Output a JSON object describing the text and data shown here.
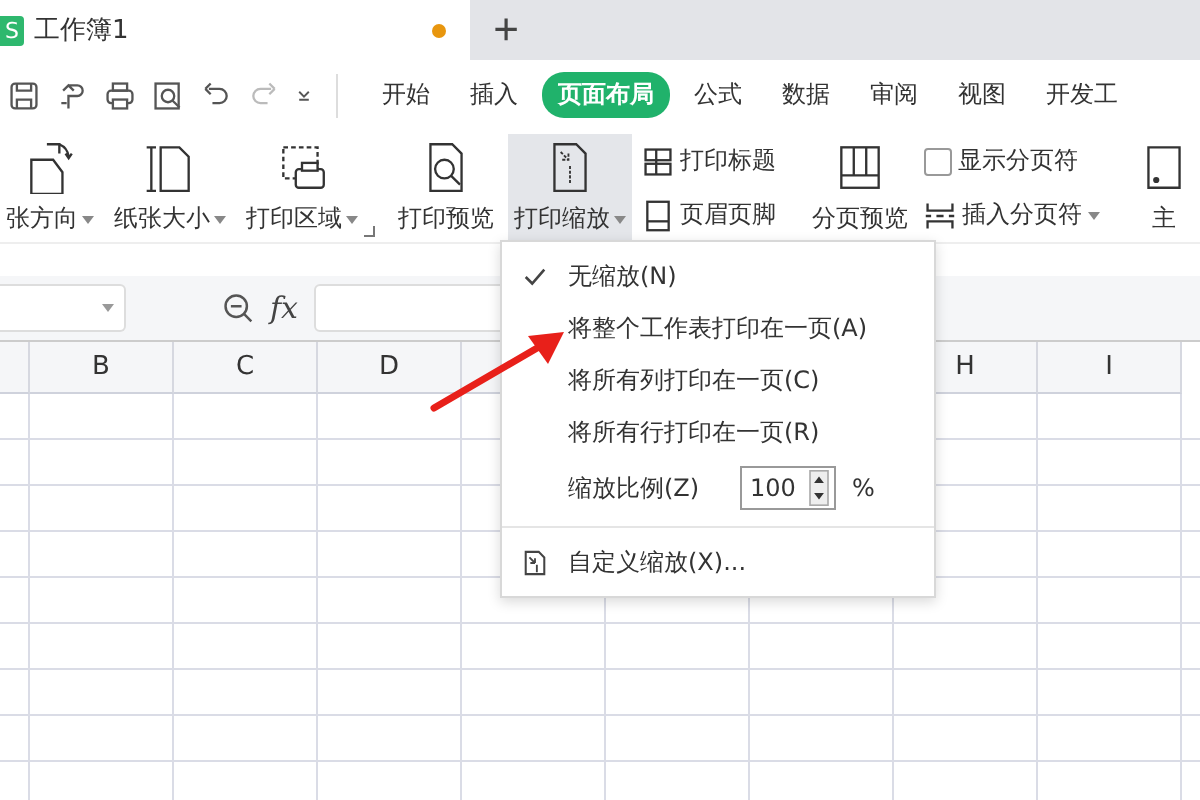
{
  "document_tab": {
    "logo": "S",
    "title": "工作簿1",
    "unsaved": true,
    "new_tab": "+"
  },
  "menu_tabs": [
    {
      "label": "开始",
      "selected": false
    },
    {
      "label": "插入",
      "selected": false
    },
    {
      "label": "页面布局",
      "selected": true
    },
    {
      "label": "公式",
      "selected": false
    },
    {
      "label": "数据",
      "selected": false
    },
    {
      "label": "审阅",
      "selected": false
    },
    {
      "label": "视图",
      "selected": false
    },
    {
      "label": "开发工",
      "selected": false
    }
  ],
  "ribbon_groups": [
    {
      "launcher": true,
      "items": [
        {
          "kind": "large",
          "label": "张方向",
          "dropdown": true,
          "selected": false
        },
        {
          "kind": "large",
          "label": "纸张大小",
          "dropdown": true,
          "selected": false
        },
        {
          "kind": "large",
          "label": "打印区域",
          "dropdown": true,
          "selected": false
        }
      ]
    },
    {
      "items": [
        {
          "kind": "large",
          "label": "打印预览",
          "selected": false
        },
        {
          "kind": "large",
          "label": "打印缩放",
          "dropdown": true,
          "selected": true
        },
        {
          "kind": "stack",
          "items": [
            {
              "kind": "button",
              "label": "打印标题"
            },
            {
              "kind": "button",
              "label": "页眉页脚"
            }
          ]
        }
      ]
    },
    {
      "items": [
        {
          "kind": "large",
          "label": "分页预览",
          "selected": false
        },
        {
          "kind": "stack",
          "items": [
            {
              "kind": "checkbox",
              "label": "显示分页符",
              "checked": false
            },
            {
              "kind": "button",
              "label": "插入分页符",
              "dropdown": true
            }
          ]
        }
      ]
    },
    {
      "items": [
        {
          "kind": "large",
          "label": "主",
          "selected": false
        }
      ]
    }
  ],
  "formula_bar": {
    "fx": "fx"
  },
  "column_headers": [
    "B",
    "C",
    "D",
    "H",
    "I"
  ],
  "zoom_menu": {
    "items": [
      {
        "kind": "option",
        "label": "无缩放(N)",
        "checked": true
      },
      {
        "kind": "option",
        "label": "将整个工作表打印在一页(A)",
        "checked": false
      },
      {
        "kind": "option",
        "label": "将所有列打印在一页(C)",
        "checked": false
      },
      {
        "kind": "option",
        "label": "将所有行打印在一页(R)",
        "checked": false
      },
      {
        "kind": "scale",
        "label": "缩放比例(Z)",
        "value": "100",
        "unit": "%"
      },
      {
        "kind": "custom",
        "label": "自定义缩放(X)..."
      }
    ]
  }
}
